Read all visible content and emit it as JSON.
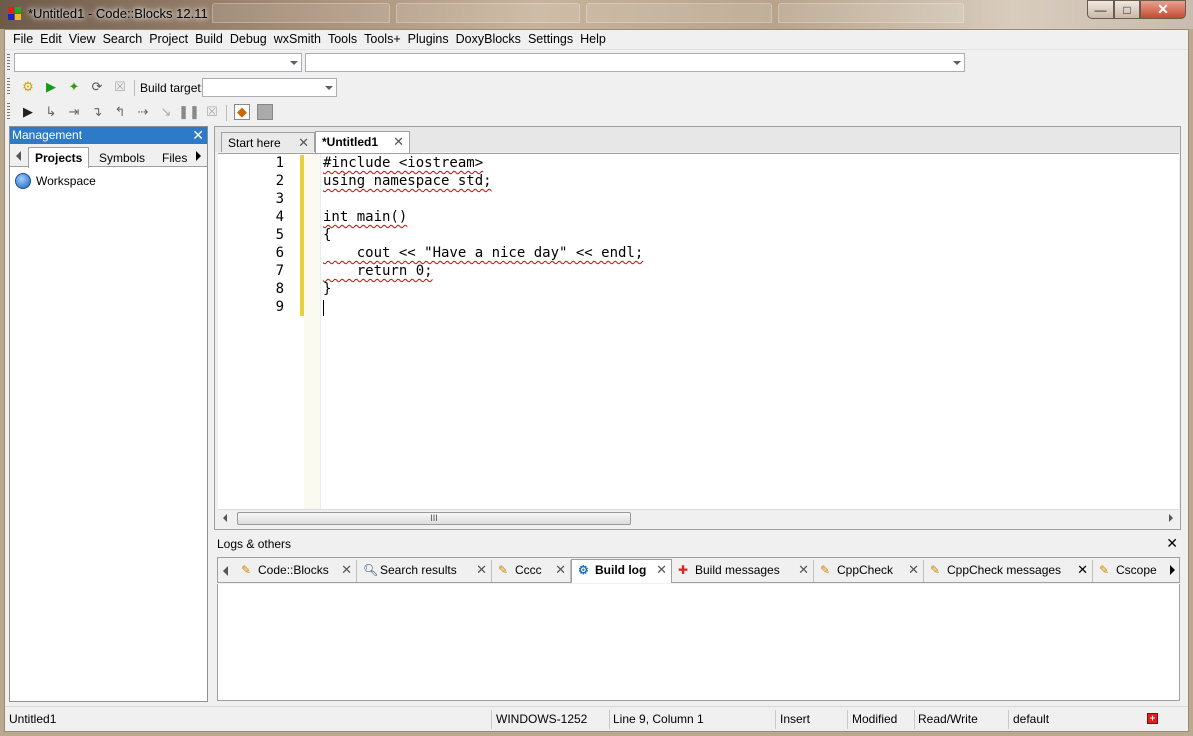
{
  "window": {
    "title": "*Untitled1 - Code::Blocks 12.11",
    "minimize_glyph": "—",
    "maximize_glyph": "□",
    "close_glyph": "✕"
  },
  "menu": [
    "File",
    "Edit",
    "View",
    "Search",
    "Project",
    "Build",
    "Debug",
    "wxSmith",
    "Tools",
    "Tools+",
    "Plugins",
    "DoxyBlocks",
    "Settings",
    "Help"
  ],
  "toolbar": {
    "build_target_label": "Build target:",
    "build_target_value": "",
    "scope_combo_value": "",
    "symbol_combo_value": ""
  },
  "management": {
    "title": "Management",
    "close_glyph": "✕",
    "tabs": [
      "Projects",
      "Symbols",
      "Files"
    ],
    "active_tab": "Projects",
    "tree": [
      "Workspace"
    ]
  },
  "editor": {
    "tabs": [
      {
        "label": "Start here",
        "active": false
      },
      {
        "label": "*Untitled1",
        "active": true
      }
    ],
    "tab_close_glyph": "✕",
    "line_numbers": [
      "1",
      "2",
      "3",
      "4",
      "5",
      "6",
      "7",
      "8",
      "9"
    ],
    "lines": [
      "#include <iostream>",
      "using namespace std;",
      "",
      "int main()",
      "{",
      "    cout << \"Have a nice day\" << endl;",
      "    return 0;",
      "}",
      ""
    ],
    "scroll_thumb_glyph": "III"
  },
  "logs": {
    "title": "Logs & others",
    "close_glyph": "✕",
    "tabs": [
      {
        "label": "Code::Blocks",
        "icon": "note-icon",
        "active": false
      },
      {
        "label": "Search results",
        "icon": "magnifier-icon",
        "active": false
      },
      {
        "label": "Cccc",
        "icon": "note-icon",
        "active": false
      },
      {
        "label": "Build log",
        "icon": "gear-icon",
        "active": true
      },
      {
        "label": "Build messages",
        "icon": "pin-icon",
        "active": false
      },
      {
        "label": "CppCheck",
        "icon": "note-icon",
        "active": false
      },
      {
        "label": "CppCheck messages",
        "icon": "note-icon",
        "active": false
      },
      {
        "label": "Cscope",
        "icon": "note-icon",
        "active": false
      }
    ]
  },
  "statusbar": {
    "file": "Untitled1",
    "encoding": "WINDOWS-1252",
    "position": "Line 9, Column 1",
    "mode": "Insert",
    "modified": "Modified",
    "access": "Read/Write",
    "profile": "default"
  },
  "colors": {
    "management_header": "#2d7ac9",
    "changebar": "#e8d23c",
    "squiggle": "#dd0000"
  }
}
